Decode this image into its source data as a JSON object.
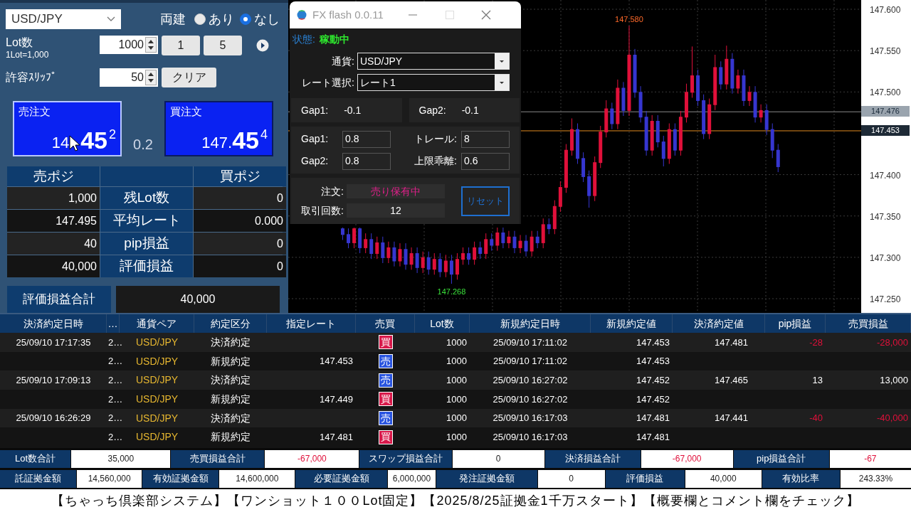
{
  "left_panel": {
    "pair_select": {
      "value": "USD/JPY"
    },
    "hedge": {
      "label": "両建",
      "options": [
        {
          "label": "あり",
          "selected": false
        },
        {
          "label": "なし",
          "selected": true
        }
      ]
    },
    "lot": {
      "label": "Lot数",
      "note": "1Lot=1,000",
      "value": "1000",
      "buttons": [
        "1",
        "5"
      ]
    },
    "slippage": {
      "label": "許容ｽﾘｯﾌﾟ",
      "value": "50",
      "button": "クリア"
    },
    "sell_order": {
      "label": "売注文",
      "price_small": "14",
      "price_big": "45",
      "price_sup": "2"
    },
    "spread": "0.2",
    "buy_order": {
      "label": "買注文",
      "price_small": "147.",
      "price_big": "45",
      "price_sup": "4"
    },
    "positions": {
      "sell_header": "売ポジ",
      "buy_header": "買ポジ",
      "rows": [
        {
          "label": "残Lot数",
          "sell": "1,000",
          "buy": "0"
        },
        {
          "label": "平均レート",
          "sell": "147.495",
          "buy": "0.000"
        },
        {
          "label": "pip損益",
          "sell": "40",
          "buy": "0"
        },
        {
          "label": "評価損益",
          "sell": "40,000",
          "buy": "0"
        }
      ]
    },
    "total": {
      "label": "評価損益合計",
      "value": "40,000"
    }
  },
  "chart": {
    "chart_data": {
      "type": "candlestick",
      "grid": true,
      "ylim": [
        147.2328,
        147.6112
      ],
      "yticks": [
        {
          "value": 147.6,
          "label": "147.600"
        },
        {
          "value": 147.55,
          "label": "147.550"
        },
        {
          "value": 147.5,
          "label": "147.500"
        },
        {
          "value": 147.4,
          "label": "147.400"
        },
        {
          "value": 147.35,
          "label": "147.350"
        },
        {
          "value": 147.3,
          "label": "147.300"
        },
        {
          "value": 147.25,
          "label": "147.250"
        }
      ],
      "categories": [
        null,
        null,
        null,
        null,
        null,
        null,
        null,
        null,
        null,
        null,
        null,
        null,
        null,
        null,
        null,
        null,
        null,
        null,
        null,
        null,
        null,
        null,
        null,
        null,
        null,
        null,
        null,
        null,
        null,
        null,
        null,
        null,
        null,
        null,
        null,
        null,
        null,
        null,
        null,
        null,
        null,
        null,
        null,
        null,
        null,
        null,
        null,
        null,
        null,
        null,
        null,
        null,
        null,
        null,
        null,
        null,
        null,
        null,
        null,
        null,
        null,
        null,
        null,
        null,
        null,
        null,
        null,
        null,
        null,
        null,
        null,
        null,
        null,
        null,
        null,
        null,
        null,
        null,
        null,
        null,
        null,
        null,
        null,
        null,
        null,
        null,
        null,
        null,
        null,
        null,
        null,
        null,
        null,
        null,
        null,
        null,
        null,
        null,
        null,
        null
      ],
      "ohlc": [
        null,
        null,
        null,
        null,
        null,
        null,
        null,
        null,
        null,
        [
          147.335,
          147.336,
          147.321,
          147.328
        ],
        [
          147.328,
          147.335,
          147.311,
          147.318
        ],
        [
          147.318,
          147.336,
          147.311,
          147.335
        ],
        [
          147.335,
          147.336,
          147.305,
          147.312
        ],
        [
          147.312,
          147.329,
          147.305,
          147.322
        ],
        [
          147.322,
          147.329,
          147.298,
          147.305
        ],
        [
          147.305,
          147.325,
          147.298,
          147.318
        ],
        [
          147.318,
          147.325,
          147.293,
          147.3
        ],
        [
          147.3,
          147.319,
          147.293,
          147.312
        ],
        [
          147.312,
          147.319,
          147.289,
          147.296
        ],
        [
          147.296,
          147.317,
          147.289,
          147.31
        ],
        [
          147.31,
          147.317,
          147.285,
          147.292
        ],
        [
          147.292,
          147.312,
          147.285,
          147.305
        ],
        [
          147.305,
          147.312,
          147.281,
          147.288
        ],
        [
          147.288,
          147.307,
          147.281,
          147.3
        ],
        [
          147.3,
          147.307,
          147.279,
          147.286
        ],
        [
          147.286,
          147.305,
          147.279,
          147.298
        ],
        [
          147.298,
          147.305,
          147.276,
          147.283
        ],
        [
          147.283,
          147.303,
          147.276,
          147.296
        ],
        [
          147.296,
          147.303,
          147.268,
          147.28
        ],
        [
          147.28,
          147.305,
          147.273,
          147.298
        ],
        [
          147.298,
          147.312,
          147.291,
          147.305
        ],
        [
          147.305,
          147.312,
          147.291,
          147.298
        ],
        [
          147.298,
          147.319,
          147.291,
          147.312
        ],
        [
          147.312,
          147.319,
          147.298,
          147.305
        ],
        [
          147.305,
          147.329,
          147.298,
          147.322
        ],
        [
          147.322,
          147.329,
          147.308,
          147.315
        ],
        [
          147.315,
          147.336,
          147.308,
          147.33
        ],
        [
          147.33,
          147.336,
          147.311,
          147.318
        ],
        [
          147.318,
          147.332,
          147.311,
          147.325
        ],
        [
          147.325,
          147.332,
          147.305,
          147.312
        ],
        [
          147.312,
          147.327,
          147.305,
          147.32
        ],
        [
          147.32,
          147.327,
          147.301,
          147.308
        ],
        [
          147.308,
          147.332,
          147.301,
          147.325
        ],
        [
          147.325,
          147.332,
          147.311,
          147.318
        ],
        [
          147.318,
          147.347,
          147.311,
          147.34
        ],
        [
          147.34,
          147.347,
          147.328,
          147.335
        ],
        [
          147.335,
          147.369,
          147.328,
          147.362
        ],
        [
          147.362,
          147.392,
          147.355,
          147.385
        ],
        [
          147.385,
          147.437,
          147.378,
          147.43
        ],
        [
          147.43,
          147.468,
          147.423,
          147.455
        ],
        [
          147.455,
          147.462,
          147.413,
          147.42
        ],
        [
          147.42,
          147.427,
          147.391,
          147.398
        ],
        [
          147.398,
          147.405,
          147.36,
          147.375
        ],
        [
          147.375,
          147.422,
          147.368,
          147.415
        ],
        [
          147.415,
          147.459,
          147.408,
          147.452
        ],
        [
          147.452,
          147.49,
          147.445,
          147.48
        ],
        [
          147.48,
          147.487,
          147.455,
          147.462
        ],
        [
          147.462,
          147.515,
          147.455,
          147.505
        ],
        [
          147.505,
          147.512,
          147.471,
          147.478
        ],
        [
          147.478,
          147.58,
          147.471,
          147.545
        ],
        [
          147.545,
          147.552,
          147.493,
          147.5
        ],
        [
          147.5,
          147.507,
          147.463,
          147.47
        ],
        [
          147.47,
          147.477,
          147.423,
          147.43
        ],
        [
          147.43,
          147.472,
          147.423,
          147.465
        ],
        [
          147.465,
          147.472,
          147.433,
          147.44
        ],
        [
          147.44,
          147.447,
          147.41,
          147.42
        ],
        [
          147.42,
          147.462,
          147.413,
          147.455
        ],
        [
          147.455,
          147.462,
          147.423,
          147.43
        ],
        [
          147.43,
          147.477,
          147.423,
          147.47
        ],
        [
          147.47,
          147.51,
          147.463,
          147.5
        ],
        [
          147.5,
          147.555,
          147.493,
          147.52
        ],
        [
          147.52,
          147.527,
          147.483,
          147.49
        ],
        [
          147.49,
          147.497,
          147.443,
          147.45
        ],
        [
          147.45,
          147.492,
          147.443,
          147.485
        ],
        [
          147.485,
          147.545,
          147.478,
          147.53
        ],
        [
          147.53,
          147.537,
          147.503,
          147.51
        ],
        [
          147.51,
          147.556,
          147.503,
          147.54
        ],
        [
          147.54,
          147.547,
          147.498,
          147.505
        ],
        [
          147.505,
          147.527,
          147.498,
          147.52
        ],
        [
          147.52,
          147.527,
          147.483,
          147.49
        ],
        [
          147.49,
          147.507,
          147.483,
          147.5
        ],
        [
          147.5,
          147.507,
          147.463,
          147.47
        ],
        [
          147.47,
          147.485,
          147.463,
          147.478
        ],
        [
          147.478,
          147.485,
          147.448,
          147.455
        ],
        [
          147.455,
          147.462,
          147.42,
          147.43
        ],
        [
          147.43,
          147.437,
          147.403,
          147.41
        ],
        null,
        null,
        null,
        null,
        null,
        null,
        null,
        null,
        null,
        null,
        null,
        null,
        null,
        null
      ],
      "ref_lines": [
        {
          "axis": "y",
          "value": 147.476,
          "label": "147.476",
          "color": "#8a8a8a"
        },
        {
          "axis": "y",
          "value": 147.453,
          "label": "147.453",
          "color": "#e08a20"
        }
      ],
      "annotations": [
        "147.580",
        "147.268"
      ]
    }
  },
  "fx_flash": {
    "title": "FX flash 0.0.11",
    "status_label": "状態:",
    "status": "稼動中",
    "currency": {
      "label": "通貨:",
      "value": "USD/JPY"
    },
    "rate": {
      "label": "レート選択:",
      "value": "レート1"
    },
    "gap_readouts": [
      {
        "label": "Gap1:",
        "value": "-0.1"
      },
      {
        "label": "Gap2:",
        "value": "-0.1"
      }
    ],
    "params": [
      {
        "label": "Gap1:",
        "value": "0.8"
      },
      {
        "label": "トレール:",
        "value": "8"
      },
      {
        "label": "Gap2:",
        "value": "0.8"
      },
      {
        "label": "上限乖離:",
        "value": "0.6"
      }
    ],
    "order_label": "注文:",
    "order_status": "売り保有中",
    "count_label": "取引回数:",
    "count": "12",
    "reset_button": "リセット"
  },
  "history": {
    "columns": [
      "決済約定日時",
      "…",
      "通貨ペア",
      "約定区分",
      "指定レート",
      "売買",
      "Lot数",
      "新規約定日時",
      "新規約定値",
      "決済約定値",
      "pip損益",
      "売買損益"
    ],
    "rows": [
      {
        "settle_time": "25/09/10 17:17:35",
        "id": "2…",
        "pair": "USD/JPY",
        "type": "決済約定",
        "side": {
          "kind": "buy",
          "label": "買"
        },
        "lot": "1000",
        "new_time": "25/09/10 17:11:02",
        "new_price": "147.453",
        "settle_price": "147.481",
        "pip": "-28",
        "pnl": "-28,000",
        "loss": true
      },
      {
        "id": "2…",
        "pair": "USD/JPY",
        "type": "新規約定",
        "rate": "147.453",
        "side": {
          "kind": "sell",
          "label": "売"
        },
        "lot": "1000",
        "new_time": "25/09/10 17:11:02",
        "new_price": "147.453"
      },
      {
        "settle_time": "25/09/10 17:09:13",
        "id": "2…",
        "pair": "USD/JPY",
        "type": "決済約定",
        "side": {
          "kind": "sell",
          "label": "売"
        },
        "lot": "1000",
        "new_time": "25/09/10 16:27:02",
        "new_price": "147.452",
        "settle_price": "147.465",
        "pip": "13",
        "pnl": "13,000",
        "loss": false
      },
      {
        "id": "2…",
        "pair": "USD/JPY",
        "type": "新規約定",
        "rate": "147.449",
        "side": {
          "kind": "buy",
          "label": "買"
        },
        "lot": "1000",
        "new_time": "25/09/10 16:27:02",
        "new_price": "147.452"
      },
      {
        "settle_time": "25/09/10 16:26:29",
        "id": "2…",
        "pair": "USD/JPY",
        "type": "決済約定",
        "side": {
          "kind": "sell",
          "label": "売"
        },
        "lot": "1000",
        "new_time": "25/09/10 16:17:03",
        "new_price": "147.481",
        "settle_price": "147.441",
        "pip": "-40",
        "pnl": "-40,000",
        "loss": true
      },
      {
        "id": "2…",
        "pair": "USD/JPY",
        "type": "新規約定",
        "rate": "147.481",
        "side": {
          "kind": "buy",
          "label": "買"
        },
        "lot": "1000",
        "new_time": "25/09/10 16:17:03",
        "new_price": "147.481"
      }
    ]
  },
  "summary": [
    [
      {
        "label": "Lot数合計",
        "value": "35,000",
        "loss": false
      },
      {
        "label": "売買損益合計",
        "value": "-67,000",
        "loss": true
      },
      {
        "label": "スワップ損益合計",
        "value": "0",
        "loss": false
      },
      {
        "label": "決済損益合計",
        "value": "-67,000",
        "loss": true
      },
      {
        "label": "pip損益合計",
        "value": "-67",
        "loss": true
      }
    ],
    [
      {
        "label": "託証拠金額",
        "value": "14,560,000",
        "loss": false
      },
      {
        "label": "有効証拠金額",
        "value": "14,600,000",
        "loss": false
      },
      {
        "label": "必要証拠金額",
        "value": "6,000,000",
        "loss": false
      },
      {
        "label": "発注証拠金額",
        "value": "0",
        "loss": false
      },
      {
        "label": "評価損益",
        "value": "40,000",
        "loss": false
      },
      {
        "label": "有効比率",
        "value": "243.33%",
        "loss": false
      }
    ]
  ],
  "banner": "【ちゃっち倶楽部システム】【ワンショット１００Lot固定】【2025/8/25証拠金1千万スタート】【概要欄とコメント欄をチェック】"
}
